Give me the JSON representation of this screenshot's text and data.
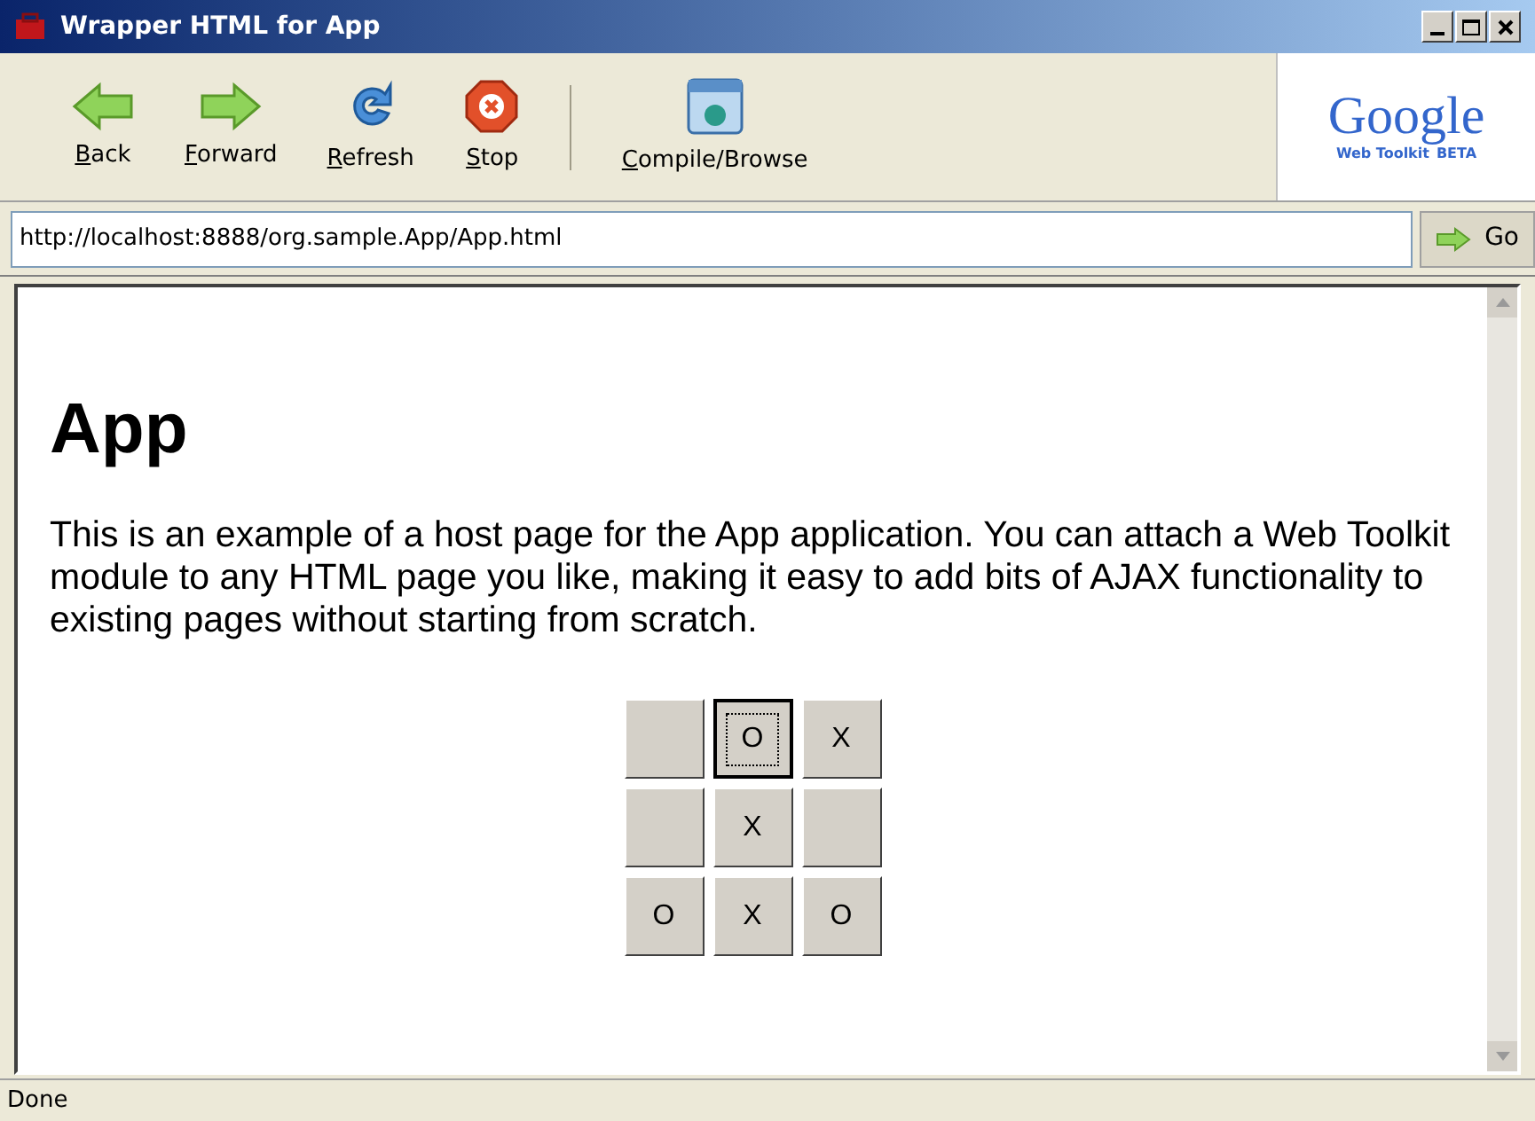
{
  "window": {
    "title": "Wrapper HTML for App"
  },
  "toolbar": [
    {
      "kind": "back",
      "label": "Back"
    },
    {
      "kind": "forward",
      "label": "Forward"
    },
    {
      "kind": "refresh",
      "label": "Refresh"
    },
    {
      "kind": "stop",
      "label": "Stop"
    },
    {
      "kind": "compile",
      "label": "Compile/Browse"
    }
  ],
  "logo": {
    "name": "Google",
    "subtitle": "Web Toolkit",
    "badge": "BETA"
  },
  "address_bar": {
    "value": "http://localhost:8888/org.sample.App/App.html",
    "go_label": "Go"
  },
  "page": {
    "heading": "App",
    "paragraph": "This is an example of a host page for the App application. You can attach a Web Toolkit module to any HTML page you like, making it easy to add bits of AJAX functionality to existing pages without starting from scratch."
  },
  "board": [
    {
      "selected": false
    },
    {
      "mark": "O",
      "selected": true
    },
    {
      "mark": "X",
      "selected": false
    },
    {
      "selected": false
    },
    {
      "mark": "X",
      "selected": false
    },
    {
      "selected": false
    },
    {
      "mark": "O",
      "selected": false
    },
    {
      "mark": "X",
      "selected": false
    },
    {
      "mark": "O",
      "selected": false
    }
  ],
  "status_bar": {
    "text": "Done"
  }
}
